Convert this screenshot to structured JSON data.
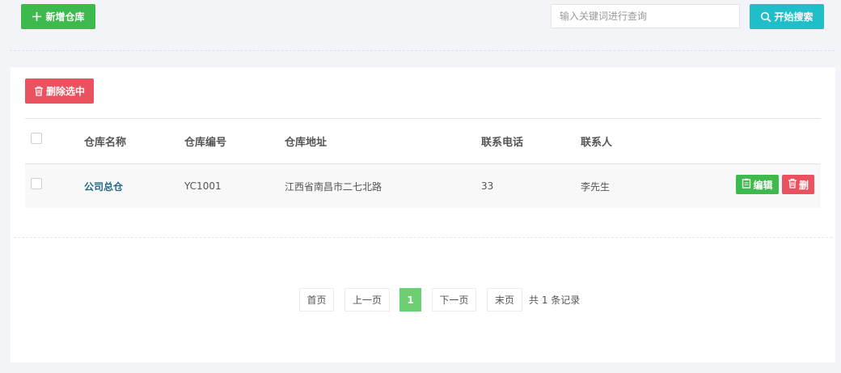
{
  "toolbar": {
    "add_label": "新增仓库",
    "search_placeholder": "输入关键词进行查询",
    "search_value": "",
    "search_label": "开始搜索"
  },
  "actions": {
    "delete_selected_label": "删除选中"
  },
  "table": {
    "columns": [
      "仓库名称",
      "仓库编号",
      "仓库地址",
      "联系电话",
      "联系人"
    ],
    "rows": [
      {
        "name": "公司总仓",
        "code": "YC1001",
        "address": "江西省南昌市二七北路",
        "phone": "33",
        "contact": "李先生",
        "edit_label": "编辑",
        "delete_label": "删"
      }
    ]
  },
  "pagination": {
    "first": "首页",
    "prev": "上一页",
    "current": "1",
    "next": "下一页",
    "last": "末页",
    "total": "共 1 条记录"
  },
  "colors": {
    "green": "#3eb94e",
    "teal": "#1fbfc9",
    "red": "#e9525e",
    "link": "#256a8a",
    "active_page": "#6dce72"
  },
  "icons": [
    "plus-icon",
    "search-icon",
    "trash-icon",
    "clipboard-icon"
  ]
}
